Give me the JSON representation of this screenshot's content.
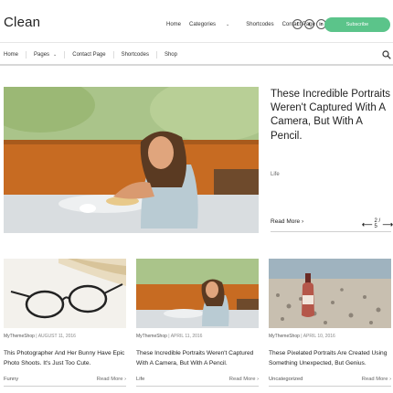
{
  "site": {
    "logo": "Clean",
    "subscribe_label": "Subscribe"
  },
  "topnav": {
    "items": [
      "Home",
      "Categories",
      "Shortcodes",
      "Contact Page"
    ]
  },
  "socials": [
    "f",
    "t",
    "in",
    "p"
  ],
  "mainnav": {
    "items": [
      "Home",
      "Pages",
      "Contact Page",
      "Shortcodes",
      "Shop"
    ]
  },
  "hero": {
    "title": "These Incredible Portraits Weren't Captured With A Camera, But With A Pencil.",
    "category": "Life",
    "read_more": "Read More ›",
    "pager": "2 / 5"
  },
  "cards": [
    {
      "author": "MyThemeShop",
      "date": "AUGUST 11, 2016",
      "title": "This Photographer And Her Bunny Have Epic Photo Shoots. It's Just Too Cute.",
      "category": "Funny",
      "read_more": "Read More ›"
    },
    {
      "author": "MyThemeShop",
      "date": "APRIL 11, 2016",
      "title": "These Incredible Portraits Weren't Captured With A Camera, But With A Pencil.",
      "category": "Life",
      "read_more": "Read More ›"
    },
    {
      "author": "MyThemeShop",
      "date": "APRIL 10, 2016",
      "title": "These Pixelated Portraits Are Created Using Something Unexpected, But Genius.",
      "category": "Uncategorized",
      "read_more": "Read More ›"
    }
  ]
}
